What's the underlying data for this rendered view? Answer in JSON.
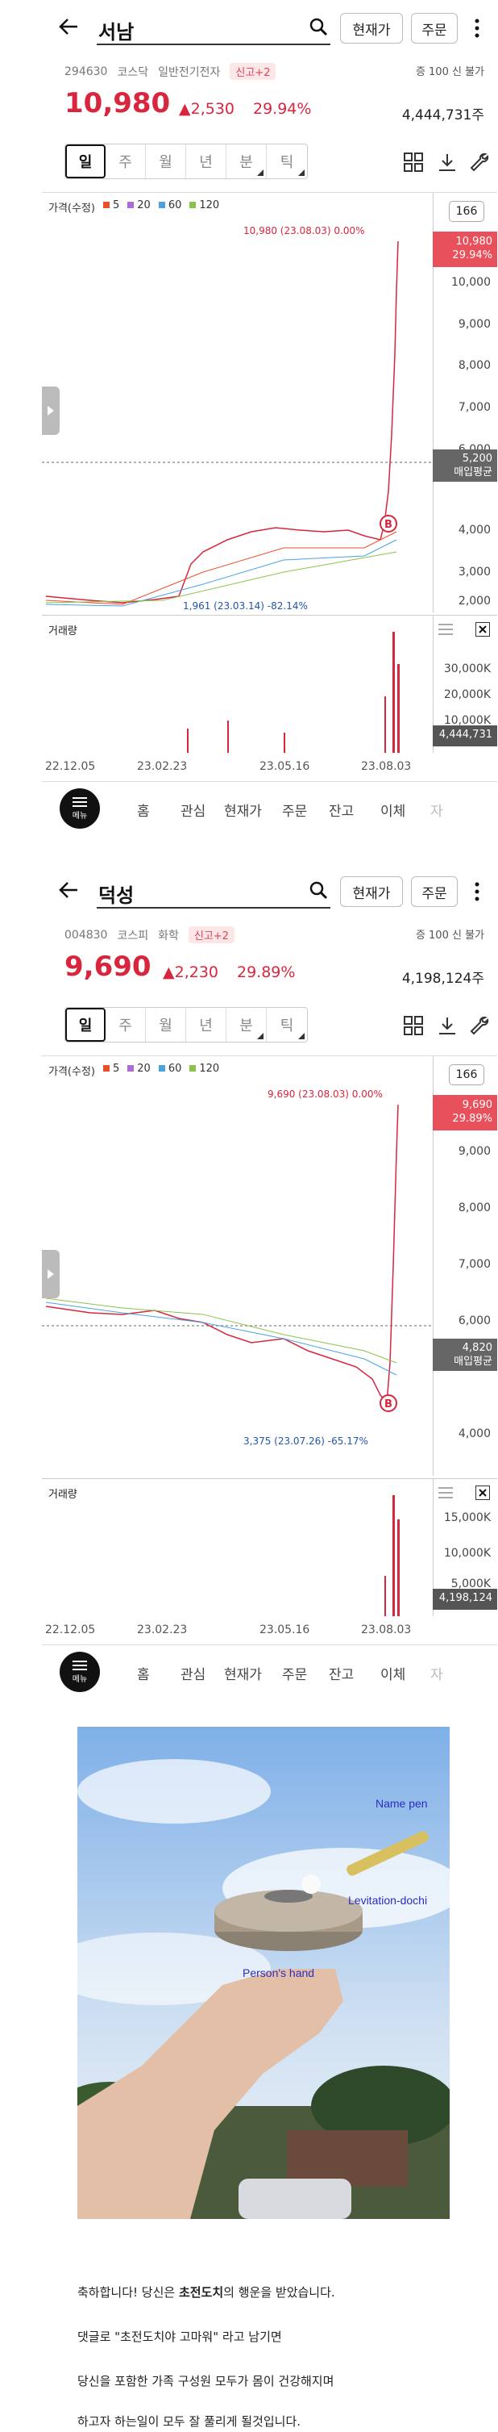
{
  "screens": [
    {
      "stock_name": "서남",
      "code": "294630",
      "market": "코스닥",
      "sector": "일반전기전자",
      "badge": "신고+2",
      "right_meta": "증 100 신 불가",
      "price": "10,980",
      "change": "▲2,530",
      "change_pct": "29.94%",
      "volume": "4,444,731주",
      "buttons": {
        "price": "현재가",
        "order": "주문"
      },
      "periods": [
        "일",
        "주",
        "월",
        "년",
        "분",
        "틱"
      ],
      "legend": {
        "label": "가격(수정)",
        "ma": [
          "5",
          "20",
          "60",
          "120"
        ]
      },
      "count": "166",
      "high_annot": "10,980 (23.08.03) 0.00%",
      "low_annot": "1,961 (23.03.14) -82.14%",
      "y_ticks": [
        "10,000",
        "9,000",
        "8,000",
        "7,000",
        "6,000",
        "4,000",
        "3,000",
        "2,000"
      ],
      "cur_box": [
        "10,980",
        "29.94%"
      ],
      "avg_box": [
        "5,200",
        "매입평균"
      ],
      "volume_title": "거래량",
      "vol_ticks": [
        "30,000K",
        "20,000K",
        "10,000K"
      ],
      "vol_box": "4,444,731",
      "dates": [
        "22.12.05",
        "23.02.23",
        "23.05.16",
        "23.08.03"
      ],
      "nav": [
        "홈",
        "관심",
        "현재가",
        "주문",
        "잔고",
        "이체",
        "자"
      ],
      "menu_label": "메뉴"
    },
    {
      "stock_name": "덕성",
      "code": "004830",
      "market": "코스피",
      "sector": "화학",
      "badge": "신고+2",
      "right_meta": "증 100 신 불가",
      "price": "9,690",
      "change": "▲2,230",
      "change_pct": "29.89%",
      "volume": "4,198,124주",
      "buttons": {
        "price": "현재가",
        "order": "주문"
      },
      "periods": [
        "일",
        "주",
        "월",
        "년",
        "분",
        "틱"
      ],
      "legend": {
        "label": "가격(수정)",
        "ma": [
          "5",
          "20",
          "60",
          "120"
        ]
      },
      "count": "166",
      "high_annot": "9,690 (23.08.03) 0.00%",
      "low_annot": "3,375 (23.07.26) -65.17%",
      "y_ticks": [
        "9,000",
        "8,000",
        "7,000",
        "6,000",
        "4,000"
      ],
      "cur_box": [
        "9,690",
        "29.89%"
      ],
      "avg_box": [
        "4,820",
        "매입평균"
      ],
      "volume_title": "거래량",
      "vol_ticks": [
        "15,000K",
        "10,000K",
        "5,000K"
      ],
      "vol_box": "4,198,124",
      "dates": [
        "22.12.05",
        "23.02.23",
        "23.05.16",
        "23.08.03"
      ],
      "nav": [
        "홈",
        "관심",
        "현재가",
        "주문",
        "잔고",
        "이체",
        "자"
      ],
      "menu_label": "메뉴"
    }
  ],
  "colors": {
    "up": "#d7263d",
    "ma5": "#e8502a",
    "ma20": "#b06ad8",
    "ma60": "#4aa3df",
    "ma120": "#8bc34a"
  },
  "photo": {
    "labels": {
      "pen": "Name pen",
      "doll": "Levitation-dochi",
      "hand": "Person's hand"
    }
  },
  "captions": [
    {
      "text_before": "축하합니다! 당신은 ",
      "strong": "초전도치",
      "text_after": "의 행운을 받았습니다."
    },
    {
      "text": "댓글로 \"초전도치야 고마워\" 라고 남기면"
    },
    {
      "text": "당신을 포함한 가족 구성원 모두가 몸이 건강해지며"
    },
    {
      "text": "하고자 하는일이 모두 잘 풀리게 될것입니다."
    }
  ]
}
